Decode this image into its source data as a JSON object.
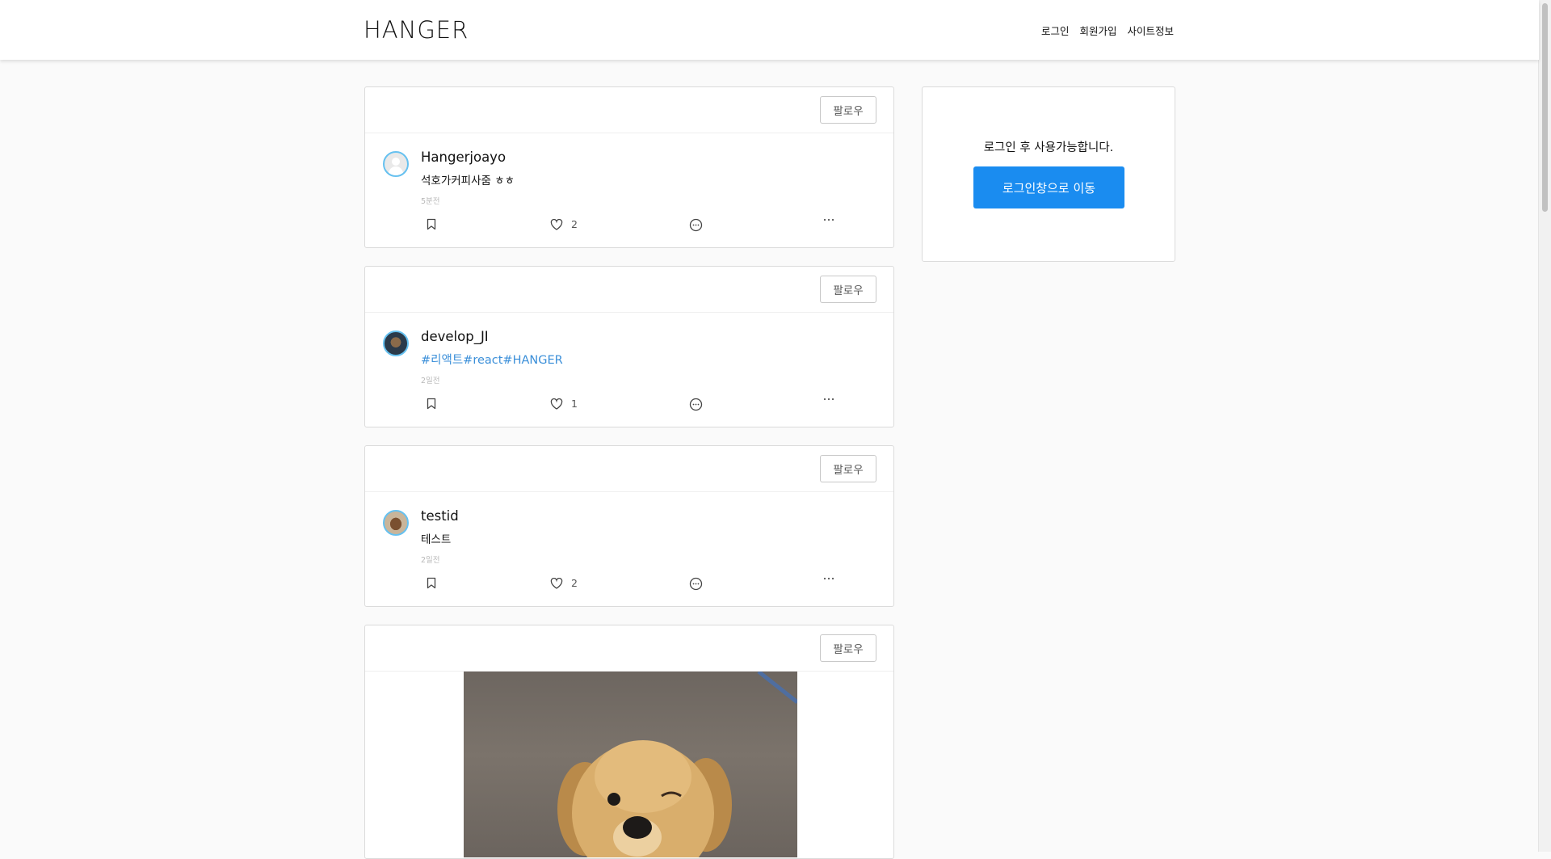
{
  "header": {
    "logo": "HANGER",
    "nav": [
      "로그인",
      "회원가입",
      "사이트정보"
    ]
  },
  "posts": [
    {
      "follow_label": "팔로우",
      "username": "Hangerjoayo",
      "caption": "석호가커피사줌 ㅎㅎ",
      "time": "5분전",
      "likes": "2"
    },
    {
      "follow_label": "팔로우",
      "username": "develop_JI",
      "caption": "#리액트#react#HANGER",
      "time": "2일전",
      "likes": "1"
    },
    {
      "follow_label": "팔로우",
      "username": "testid",
      "caption": "테스트",
      "time": "2일전",
      "likes": "2"
    },
    {
      "follow_label": "팔로우"
    }
  ],
  "sidebar": {
    "message": "로그인 후 사용가능합니다.",
    "button_label": "로그인창으로 이동"
  },
  "icons": {
    "bookmark": "bookmark-icon",
    "like": "heart-icon",
    "comment": "comment-icon",
    "more": "more-icon"
  },
  "colors": {
    "accent": "#1a8cf0",
    "hashtag": "#3b8fd9",
    "background": "#fafafa"
  }
}
